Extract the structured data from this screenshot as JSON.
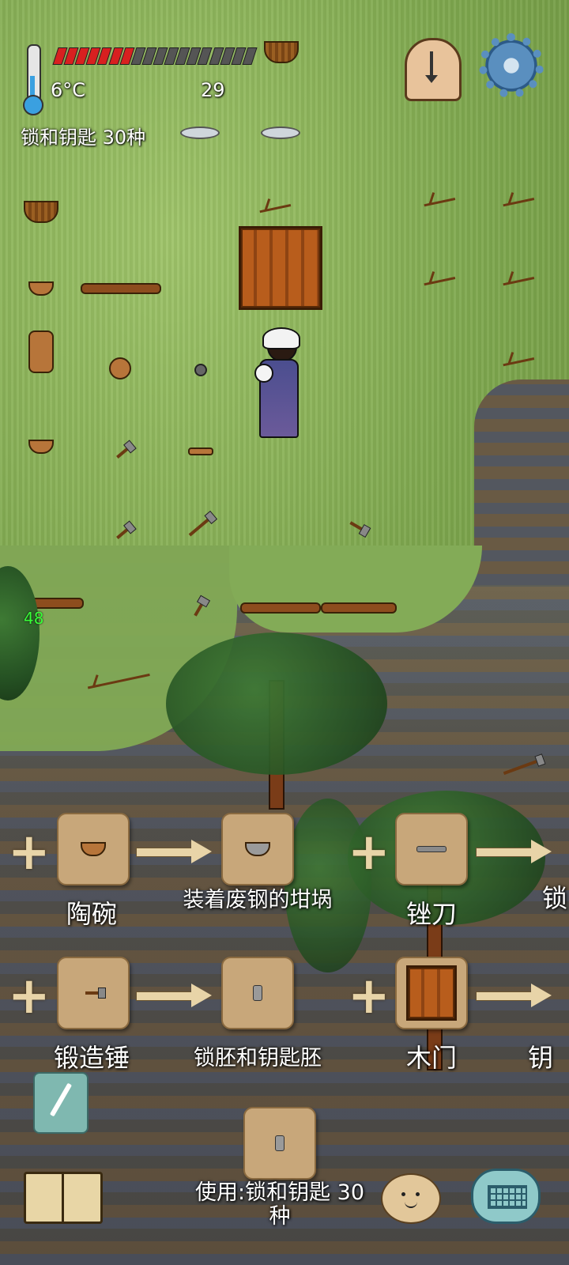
{
  "hud": {
    "temperature": "6°C",
    "food_pips_total": 18,
    "food_pips_filled": 7,
    "yum_count": "29",
    "recipe_title": "锁和钥匙 30种",
    "icons": {
      "thermometer": "thermometer-icon",
      "clock": "clock-icon",
      "settings": "gear-icon"
    }
  },
  "world": {
    "nearby_number": "48"
  },
  "recipes": {
    "row1": {
      "ingredient": "陶碗",
      "result": "装着废钢的坩埚",
      "ingredient2": "锉刀",
      "result2_partial": "锁"
    },
    "row2": {
      "ingredient": "锻造锤",
      "result": "锁胚和钥匙胚",
      "ingredient2": "木门",
      "result2_partial": "钥"
    },
    "use": {
      "label": "使用:锁和钥匙 30种"
    }
  },
  "colors": {
    "food_on": "#d82020",
    "food_off": "#555555",
    "tile_bg": "#c8a77a"
  }
}
